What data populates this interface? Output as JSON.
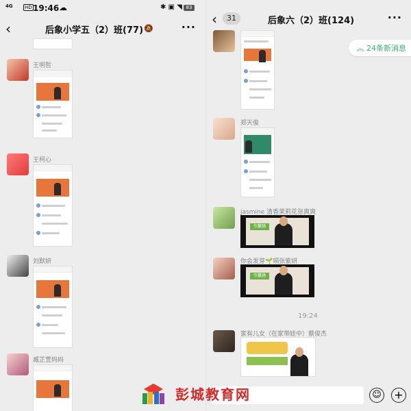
{
  "status_bar": {
    "signal": "4G",
    "hd": "HD",
    "time": "19:46",
    "battery": "83"
  },
  "left_chat": {
    "title": "后象小学五（2）班(77)",
    "messages": [
      {
        "sender": "王明哲"
      },
      {
        "sender": "王柯心"
      },
      {
        "sender": "刘默妍"
      },
      {
        "sender": "臧芷萱妈妈"
      }
    ]
  },
  "right_chat": {
    "unread_count": "31",
    "title": "后象六（2）班(124)",
    "new_messages": "24条新消息",
    "messages": [
      {
        "sender": "郑天俊"
      },
      {
        "sender": "jasmine 清香茉莉花张爽爽"
      },
      {
        "sender": "你会发芽🌱嗝张紫妍"
      },
      {
        "sender": "家有儿女（在家带娃中）蔡俊杰"
      }
    ],
    "timestamp": "19:24"
  },
  "video_sign_text": "引赢驰",
  "watermark": "彭城教育网",
  "colors": {
    "accent_green": "#3cb371",
    "watermark_red": "#d42a2a",
    "orange_banner": "#e8763a"
  }
}
